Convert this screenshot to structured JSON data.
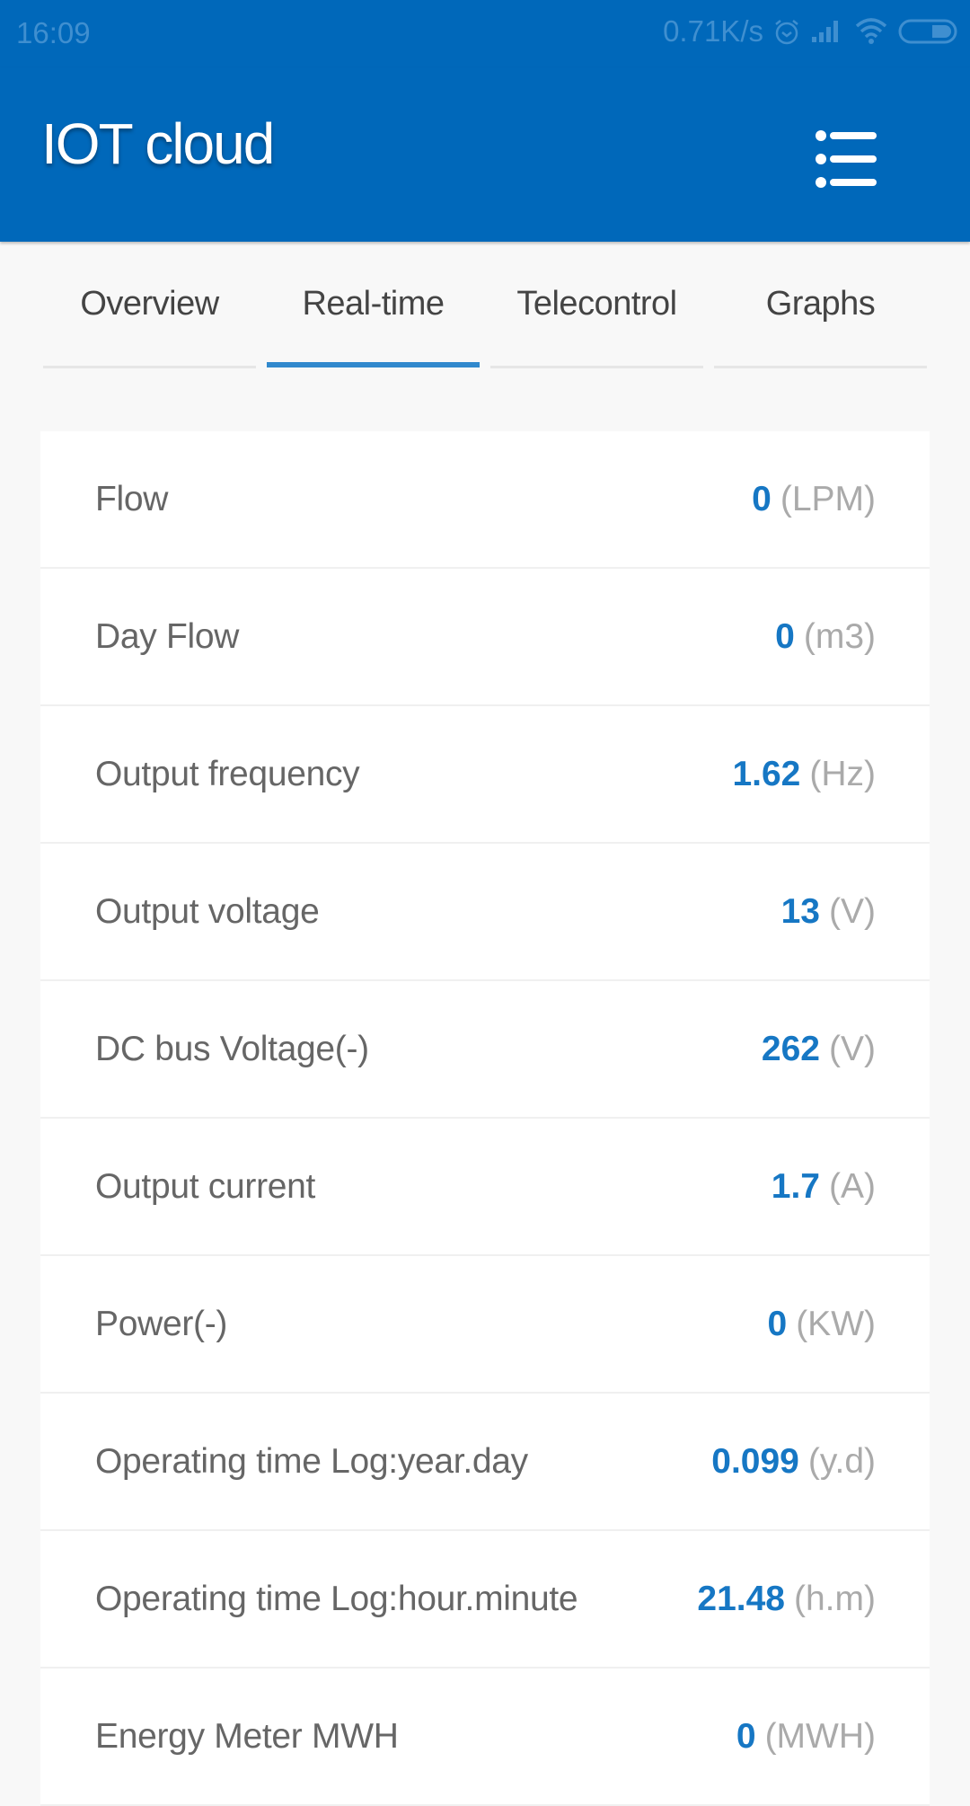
{
  "status_bar": {
    "time": "16:09",
    "network_speed": "0.71K/s",
    "icons": [
      "alarm-icon",
      "signal-icon",
      "wifi-icon",
      "battery-icon"
    ]
  },
  "app_bar": {
    "title": "IOT cloud",
    "menu_icon": "list-menu-icon"
  },
  "tabs": [
    {
      "label": "Overview",
      "active": false
    },
    {
      "label": "Real-time",
      "active": true
    },
    {
      "label": "Telecontrol",
      "active": false
    },
    {
      "label": "Graphs",
      "active": false
    }
  ],
  "readings": [
    {
      "label": "Flow",
      "value": "0",
      "unit": "(LPM)"
    },
    {
      "label": "Day Flow",
      "value": "0",
      "unit": "(m3)"
    },
    {
      "label": "Output frequency",
      "value": "1.62",
      "unit": "(Hz)"
    },
    {
      "label": "Output voltage",
      "value": "13",
      "unit": "(V)"
    },
    {
      "label": "DC bus Voltage(-)",
      "value": "262",
      "unit": "(V)"
    },
    {
      "label": "Output current",
      "value": "1.7",
      "unit": "(A)"
    },
    {
      "label": "Power(-)",
      "value": "0",
      "unit": "(KW)"
    },
    {
      "label": "Operating time Log:year.day",
      "value": "0.099",
      "unit": "(y.d)"
    },
    {
      "label": "Operating time Log:hour.minute",
      "value": "21.48",
      "unit": "(h.m)"
    },
    {
      "label": "Energy Meter MWH",
      "value": "0",
      "unit": "(MWH)"
    }
  ],
  "colors": {
    "primary": "#0068BA",
    "accent": "#3189CD",
    "value_text": "#1677C4",
    "unit_text": "#AAAAAA",
    "label_text": "#666666"
  }
}
